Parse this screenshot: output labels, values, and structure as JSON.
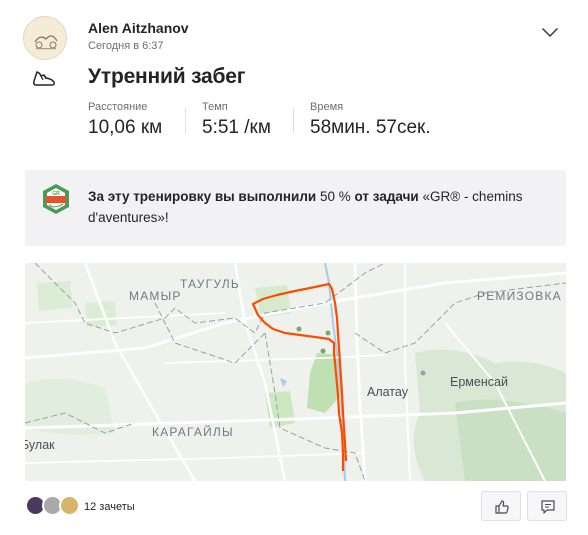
{
  "athlete": {
    "name": "Alen Aitzhanov",
    "timestamp": "Сегодня в 6:37"
  },
  "activity": {
    "sport_icon": "shoe-icon",
    "title": "Утренний забег",
    "stats": [
      {
        "label": "Расстояние",
        "value": "10,06 км"
      },
      {
        "label": "Темп",
        "value": "5:51 /км"
      },
      {
        "label": "Время",
        "value": "58мин. 57сек."
      }
    ]
  },
  "challenge": {
    "badge_icon": "challenge-badge-icon",
    "badge_text": "GR",
    "text_bold_prefix": "За эту тренировку вы выполнили",
    "percent": "50 %",
    "text_bold_middle": "от задачи",
    "challenge_name": "«GR® - chemins d'aventures»!"
  },
  "map": {
    "labels": {
      "taugul": "ТАУГУЛЬ",
      "mamyr": "МАМЫР",
      "remizovka": "РЕМИЗОВКА",
      "alatau": "Алатау",
      "ermensai": "Ерменсай",
      "karagaily": "КАРАГАЙЛЫ",
      "bulak": "Булак"
    },
    "route_color": "#fc4c02"
  },
  "footer": {
    "kudos_text": "12 зачеты",
    "kudos_icon": "thumbs-up-icon",
    "comment_icon": "comment-icon"
  },
  "colors": {
    "accent": "#fc4c02",
    "text": "#242428",
    "muted": "#6d6d78",
    "banner": "#f2f2f5"
  }
}
